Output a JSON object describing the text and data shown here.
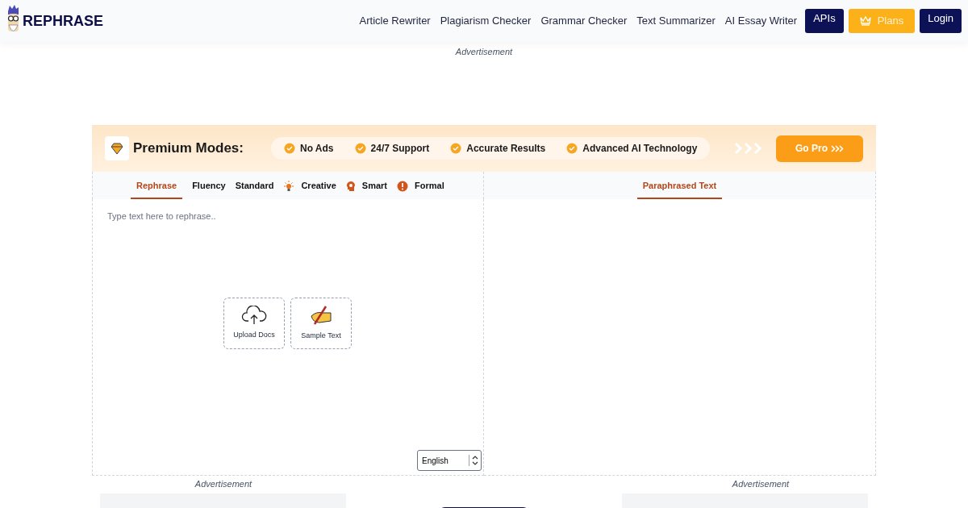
{
  "header": {
    "logo": "REPHRASE",
    "nav": [
      "Article Rewriter",
      "Plagiarism Checker",
      "Grammar Checker",
      "Text Summarizer",
      "AI Essay Writer"
    ],
    "buttons": [
      {
        "label": "APIs",
        "kind": "dark"
      },
      {
        "label": "Plans",
        "kind": "plans"
      },
      {
        "label": "Login",
        "kind": "dark"
      }
    ]
  },
  "top_ad": "Advertisement",
  "premium": {
    "title": "Premium Modes:",
    "features": [
      "No Ads",
      "24/7 Support",
      "Accurate Results",
      "Advanced AI Technology"
    ],
    "cta": "Go Pro"
  },
  "modes": [
    {
      "label": "Rephrase",
      "kind": "plain",
      "selected": true
    },
    {
      "label": "Fluency",
      "kind": "plain",
      "selected": false
    },
    {
      "label": "Standard",
      "kind": "plain",
      "selected": false
    },
    {
      "label": "Creative",
      "kind": "bulb",
      "selected": false
    },
    {
      "label": "Smart",
      "kind": "head",
      "selected": false
    },
    {
      "label": "Formal",
      "kind": "alert",
      "selected": false
    }
  ],
  "input": {
    "placeholder": "Type text here to rephrase..",
    "actions": [
      {
        "label": "Upload Docs",
        "kind": "upload"
      },
      {
        "label": "Sample Text",
        "kind": "sample"
      }
    ],
    "language": "English"
  },
  "output": {
    "tab": "Paraphrased Text"
  },
  "bottom_ads": [
    "Advertisement",
    "Advertisement"
  ]
}
